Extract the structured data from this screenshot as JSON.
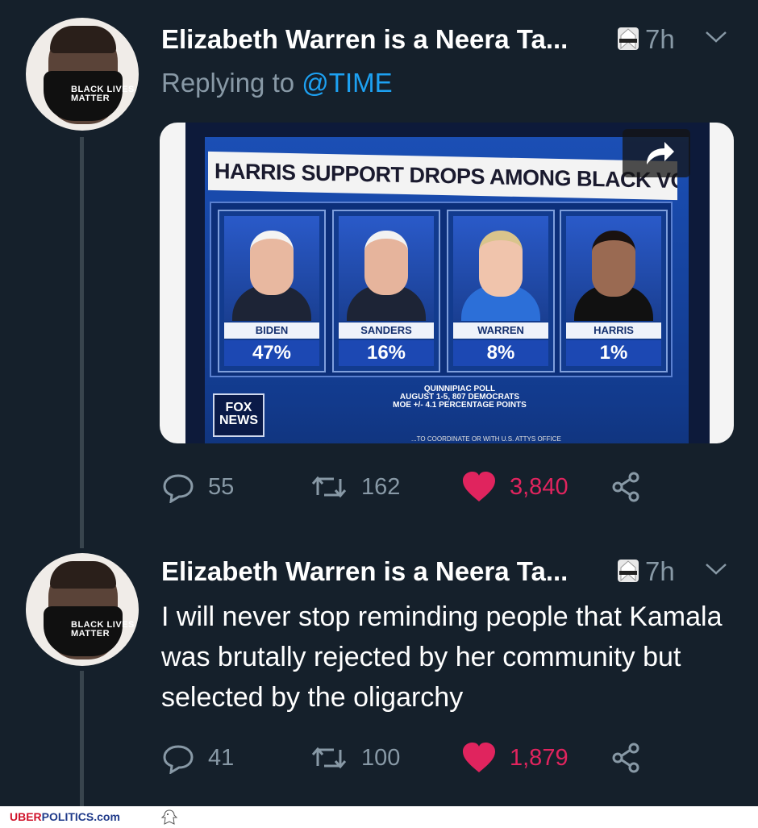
{
  "tweets": [
    {
      "author_name": "Elizabeth Warren is a Neera Ta...",
      "time": "7h",
      "reply_prefix": "Replying to",
      "reply_mention": "@TIME",
      "media": {
        "headline": "HARRIS SUPPORT DROPS AMONG BLACK VOTERS",
        "candidates": [
          {
            "name": "BIDEN",
            "pct": "47%"
          },
          {
            "name": "SANDERS",
            "pct": "16%"
          },
          {
            "name": "WARREN",
            "pct": "8%"
          },
          {
            "name": "HARRIS",
            "pct": "1%"
          }
        ],
        "source_line1": "QUINNIPIAC POLL",
        "source_line2": "AUGUST 1-5, 807 DEMOCRATS",
        "source_line3": "MOE +/- 4.1 PERCENTAGE POINTS",
        "network_logo": "FOX NEWS",
        "ticker": "...TO COORDINATE OR WITH U.S. ATTYS OFFICE"
      },
      "replies": "55",
      "retweets": "162",
      "likes": "3,840"
    },
    {
      "author_name": "Elizabeth Warren is a Neera Ta...",
      "time": "7h",
      "text": "I will never stop reminding people that Kamala was brutally rejected by her community but selected by the oligarchy",
      "replies": "41",
      "retweets": "100",
      "likes": "1,879"
    }
  ],
  "avatar_mask_text": "BLACK LIVES MATTER",
  "footer": {
    "brand_red": "UBER",
    "brand_blue": "POLITICS.com"
  },
  "colors": {
    "background": "#15202b",
    "muted": "#8899a6",
    "accent": "#1da1f2",
    "like": "#e0245e"
  },
  "icons": [
    "reply-icon",
    "retweet-icon",
    "heart-icon",
    "share-icon",
    "chevron-down-icon",
    "karate-emoji-icon"
  ]
}
